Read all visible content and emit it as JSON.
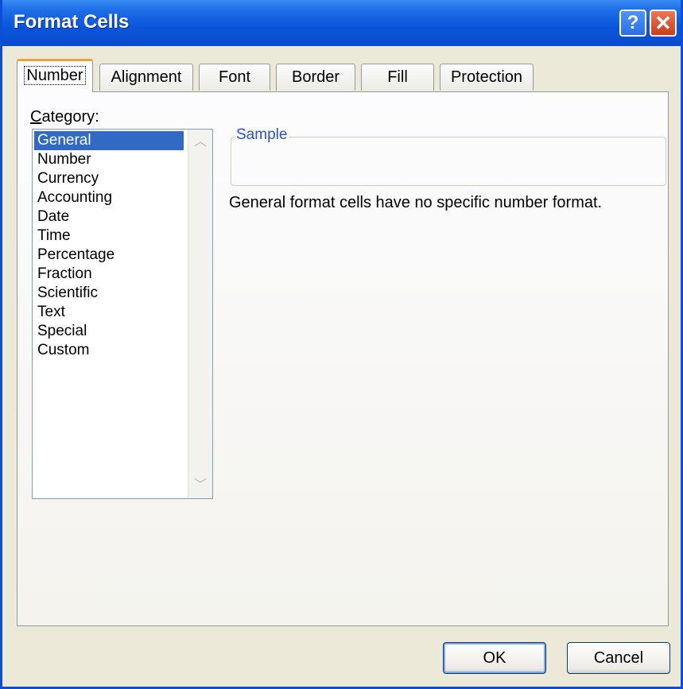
{
  "window": {
    "title": "Format Cells",
    "help_glyph": "?",
    "close_glyph": "✕"
  },
  "tabs": [
    {
      "label": "Number",
      "active": true
    },
    {
      "label": "Alignment",
      "active": false
    },
    {
      "label": "Font",
      "active": false
    },
    {
      "label": "Border",
      "active": false
    },
    {
      "label": "Fill",
      "active": false
    },
    {
      "label": "Protection",
      "active": false
    }
  ],
  "category": {
    "label_first": "C",
    "label_rest": "ategory:",
    "items": [
      "General",
      "Number",
      "Currency",
      "Accounting",
      "Date",
      "Time",
      "Percentage",
      "Fraction",
      "Scientific",
      "Text",
      "Special",
      "Custom"
    ],
    "selected": "General"
  },
  "sample": {
    "legend": "Sample"
  },
  "description": "General format cells have no specific number format.",
  "buttons": {
    "ok": "OK",
    "cancel": "Cancel"
  },
  "icons": {
    "help": "help-icon",
    "close": "close-icon",
    "scroll_up": "chevron-up-icon",
    "scroll_down": "chevron-down-icon"
  },
  "colors": {
    "titlebar": "#0a55db",
    "selection": "#316ac5",
    "active_tab_accent": "#f3a13a",
    "legend_text": "#2a52cf"
  }
}
